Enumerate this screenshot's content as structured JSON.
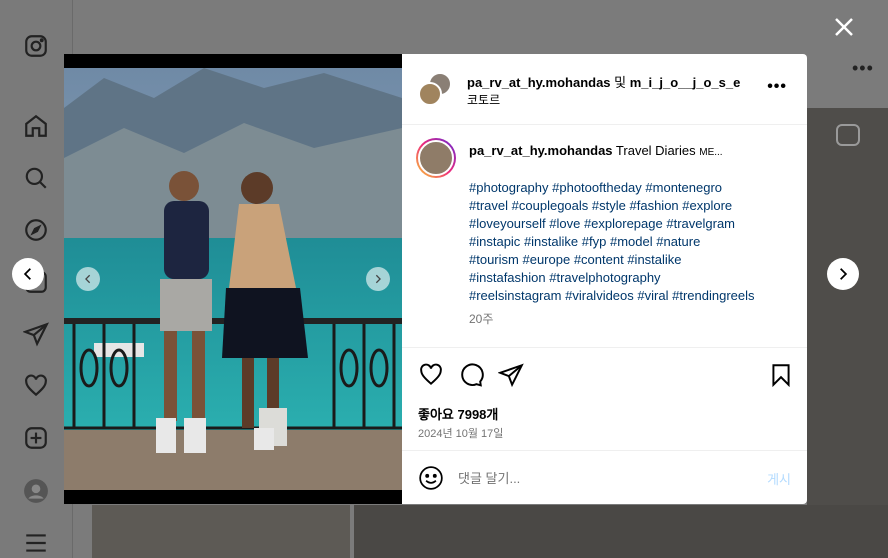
{
  "app": {
    "logo_icon": "instagram-icon"
  },
  "sidebar": {
    "items": [
      {
        "icon": "home-icon"
      },
      {
        "icon": "search-icon"
      },
      {
        "icon": "explore-icon"
      },
      {
        "icon": "reels-icon"
      },
      {
        "icon": "messages-icon"
      },
      {
        "icon": "heart-icon"
      },
      {
        "icon": "create-icon"
      },
      {
        "icon": "profile-icon"
      },
      {
        "icon": "menu-icon"
      }
    ]
  },
  "post": {
    "header": {
      "user1": "pa_rv_at_hy.mohandas",
      "and": " 및 ",
      "user2": "m_i_j_o__j_o_s_e",
      "subtitle": "코토르",
      "more": "•••"
    },
    "caption": {
      "user": "pa_rv_at_hy.mohandas",
      "text": " Travel Diaries ",
      "more_symbol": "ME...",
      "hashtags": [
        "#photography",
        "#photooftheday",
        "#montenegro",
        "#travel",
        "#couplegoals",
        "#style",
        "#fashion",
        "#explore",
        "#loveyourself",
        "#love",
        "#explorepage",
        "#travelgram",
        "#instapic",
        "#instalike",
        "#fyp",
        "#model",
        "#nature",
        "#tourism",
        "#europe",
        "#content",
        "#instalike",
        "#instafashion",
        "#travelphotography",
        "#reelsinstagram",
        "#viralvideos",
        "#viral",
        "#trendingreels"
      ],
      "time": "20주"
    },
    "likes": "좋아요 7998개",
    "date": "2024년 10월 17일",
    "comment": {
      "placeholder": "댓글 달기...",
      "post_label": "게시"
    }
  },
  "colors": {
    "hashtag": "#00376b",
    "post_button_disabled": "#b3dbff",
    "muted": "#737373",
    "overlay": "#777777"
  }
}
